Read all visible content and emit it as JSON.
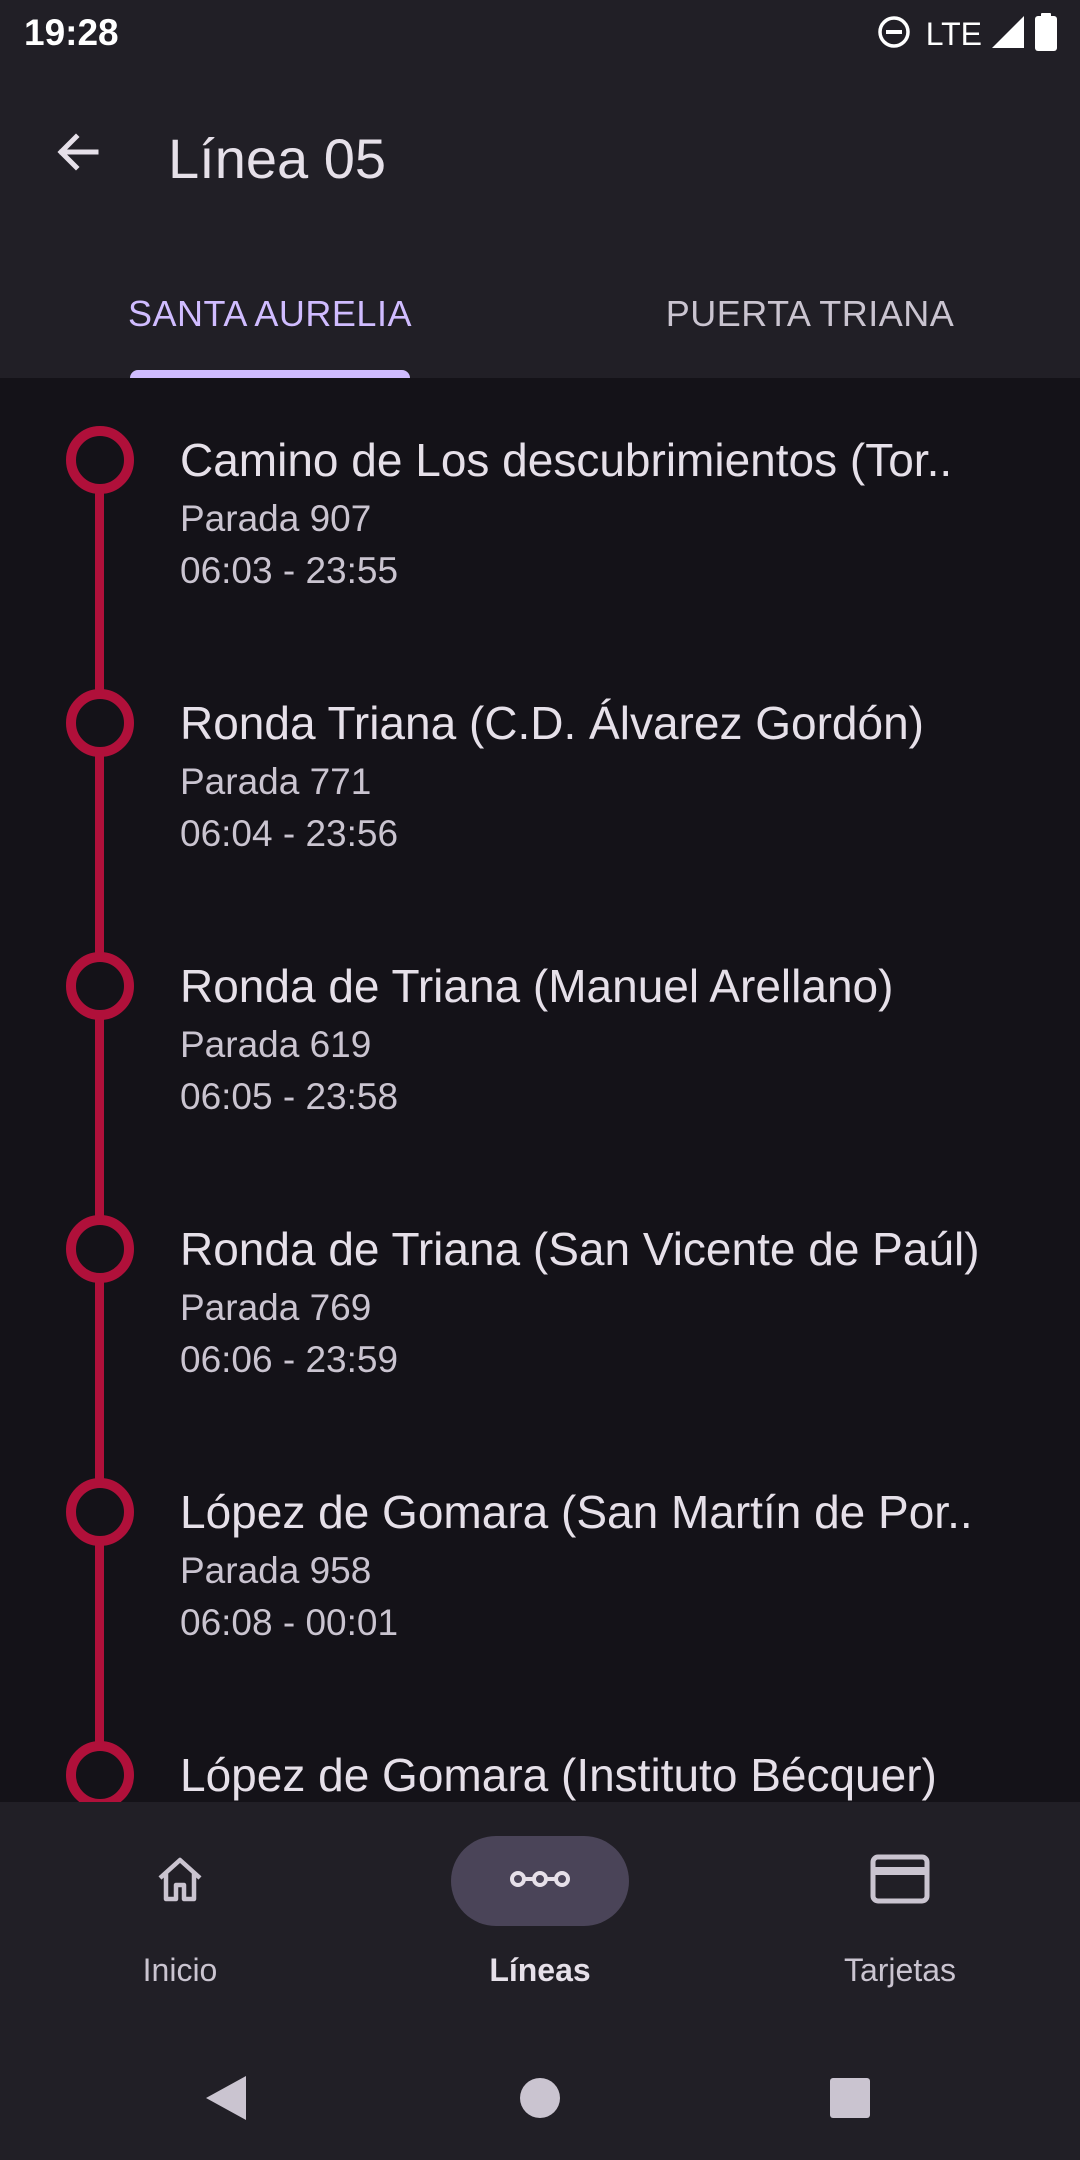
{
  "status_bar": {
    "time": "19:28",
    "network": "LTE",
    "icons": [
      "do-not-disturb-icon",
      "signal-icon",
      "battery-icon"
    ]
  },
  "header": {
    "title": "Línea 05",
    "back_icon": "arrow-back-icon"
  },
  "tabs": [
    {
      "label": "SANTA AURELIA",
      "selected": true
    },
    {
      "label": "PUERTA TRIANA",
      "selected": false
    }
  ],
  "stops": [
    {
      "name": "Camino de Los descubrimientos (Tor..",
      "code": "Parada 907",
      "hours": "06:03 - 23:55"
    },
    {
      "name": "Ronda Triana (C.D. Álvarez Gordón)",
      "code": "Parada 771",
      "hours": "06:04 - 23:56"
    },
    {
      "name": "Ronda de Triana (Manuel Arellano)",
      "code": "Parada 619",
      "hours": "06:05 - 23:58"
    },
    {
      "name": "Ronda de Triana (San Vicente de Paúl)",
      "code": "Parada 769",
      "hours": "06:06 - 23:59"
    },
    {
      "name": "López de Gomara (San Martín de Por..",
      "code": "Parada 958",
      "hours": "06:08 - 00:01"
    },
    {
      "name": "López de Gomara (Instituto Bécquer)",
      "code": "",
      "hours": ""
    }
  ],
  "colors": {
    "route": "#b0103a",
    "accent": "#d0bcff",
    "surface": "#211f26",
    "background": "#141218"
  },
  "bottom_nav": [
    {
      "label": "Inicio",
      "icon": "home-icon",
      "active": false
    },
    {
      "label": "Líneas",
      "icon": "route-icon",
      "active": true
    },
    {
      "label": "Tarjetas",
      "icon": "card-icon",
      "active": false
    }
  ]
}
